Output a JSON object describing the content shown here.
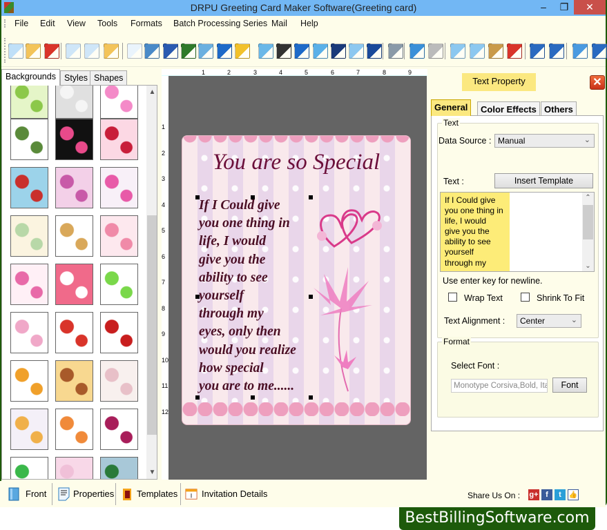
{
  "window": {
    "title": "DRPU Greeting Card Maker Software(Greeting card)",
    "controls": {
      "minimize": "–",
      "maximize": "❐",
      "close": "✕"
    }
  },
  "menu": [
    "File",
    "Edit",
    "View",
    "Tools",
    "Formats",
    "Batch Processing Series",
    "Mail",
    "Help"
  ],
  "toolbar": {
    "icons": [
      "new-icon",
      "open-icon",
      "close-icon",
      "save-icon",
      "save-as-icon",
      "open-template-icon",
      "properties-icon",
      "print-icon",
      "copy-design-icon",
      "background-icon",
      "insert-image-icon",
      "signature-icon",
      "shapes-icon",
      "watermark-icon",
      "barcode-icon",
      "text-icon",
      "word-art-icon",
      "symbol-icon",
      "mail-icon",
      "line-icon",
      "database-icon",
      "undo-icon",
      "redo-icon",
      "cut-icon",
      "copy-icon",
      "paste-icon",
      "delete-icon",
      "bring-front-icon",
      "send-back-icon",
      "grid-icon",
      "actual-size-icon"
    ]
  },
  "left_panel": {
    "tabs": [
      "Backgrounds",
      "Styles",
      "Shapes"
    ],
    "active_tab": "Backgrounds",
    "thumbnails": [
      "green-trees",
      "grey-hearts",
      "kids-cars",
      "green-hearts-ornament",
      "fireworks",
      "red-hearts",
      "santa-gifts",
      "pink-circles",
      "pink-flowers",
      "pastel-stripes",
      "teddy-bear",
      "pink-dress",
      "hearts-butterflies",
      "heart-frame-bears",
      "easter-bunnies",
      "kids-rainbow",
      "white-hearts-bows",
      "red-clover",
      "butterflies",
      "teddy-card",
      "floral-pastel",
      "daisies",
      "birthday-party",
      "cherries",
      "stars",
      "pink-texture",
      "snowmen"
    ]
  },
  "ruler": {
    "horizontal": [
      "1",
      "2",
      "3",
      "4",
      "5",
      "6",
      "7",
      "8",
      "9"
    ],
    "vertical": [
      "1",
      "2",
      "3",
      "4",
      "5",
      "6",
      "7",
      "8",
      "9",
      "10",
      "11",
      "12"
    ]
  },
  "card": {
    "title": "You are so Special",
    "body": "If I Could give\nyou one thing in\nlife, I would\ngive you the\nability to see\nyourself\nthrough my\neyes, only then\nwould you realize\nhow special\nyou are to me......"
  },
  "right_panel": {
    "header": "Text Property",
    "tabs": [
      "General",
      "Color Effects",
      "Others"
    ],
    "active_tab": "General",
    "text_group": {
      "label": "Text",
      "data_source_label": "Data Source :",
      "data_source_value": "Manual",
      "text_label": "Text :",
      "insert_template": "Insert Template",
      "text_value": "If I Could give\nyou one thing in\nlife, I would\ngive you the\nability to see\nyourself\nthrough my",
      "hint": "Use enter key for newline.",
      "wrap_text": "Wrap Text",
      "wrap_text_checked": false,
      "shrink_to_fit": "Shrink To Fit",
      "shrink_to_fit_checked": false,
      "alignment_label": "Text Alignment :",
      "alignment_value": "Center"
    },
    "format_group": {
      "label": "Format",
      "select_font_label": "Select Font :",
      "font_value": "Monotype Corsiva,Bold, Italic",
      "font_button": "Font"
    }
  },
  "bottom_bar": {
    "items": [
      "Front",
      "Properties",
      "Templates",
      "Invitation Details"
    ],
    "share_label": "Share Us On :",
    "social": [
      "g+",
      "f",
      "t",
      "👍"
    ]
  },
  "brand": "BestBillingSoftware.com"
}
